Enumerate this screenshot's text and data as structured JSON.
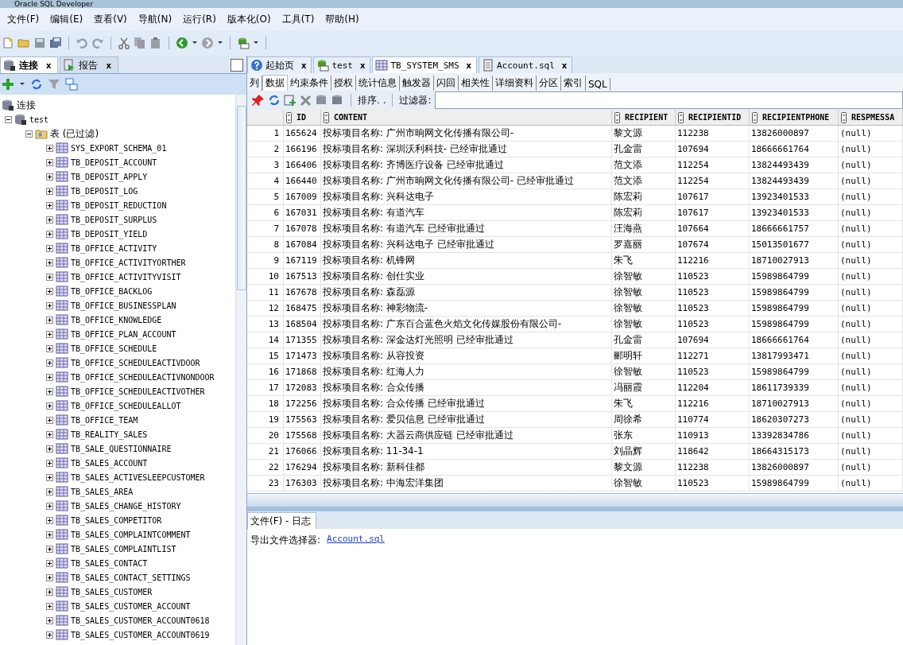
{
  "window": {
    "title": "Oracle SQL Developer"
  },
  "menu": [
    "文件(F)",
    "编辑(E)",
    "查看(V)",
    "导航(N)",
    "运行(R)",
    "版本化(O)",
    "工具(T)",
    "帮助(H)"
  ],
  "left_panel": {
    "tabs": [
      {
        "label": "连接",
        "close": "x",
        "selected": true
      },
      {
        "label": "报告",
        "close": "x",
        "selected": false
      }
    ],
    "tree": {
      "label": "连接",
      "children": [
        {
          "label": "test",
          "expanded": true,
          "children": [
            {
              "label": "表 (已过滤)",
              "expanded": true,
              "children": [
                {
                  "label": "SYS_EXPORT_SCHEMA_01",
                  "expanded": false
                },
                {
                  "label": "TB_DEPOSIT_ACCOUNT",
                  "expanded": false
                },
                {
                  "label": "TB_DEPOSIT_APPLY",
                  "expanded": false
                },
                {
                  "label": "TB_DEPOSIT_LOG",
                  "expanded": false
                },
                {
                  "label": "TB_DEPOSIT_REDUCTION",
                  "expanded": false
                },
                {
                  "label": "TB_DEPOSIT_SURPLUS",
                  "expanded": false
                },
                {
                  "label": "TB_DEPOSIT_YIELD",
                  "expanded": false
                },
                {
                  "label": "TB_OFFICE_ACTIVITY",
                  "expanded": false
                },
                {
                  "label": "TB_OFFICE_ACTIVITYORTHER",
                  "expanded": false
                },
                {
                  "label": "TB_OFFICE_ACTIVITYVISIT",
                  "expanded": false
                },
                {
                  "label": "TB_OFFICE_BACKLOG",
                  "expanded": false
                },
                {
                  "label": "TB_OFFICE_BUSINESSPLAN",
                  "expanded": false
                },
                {
                  "label": "TB_OFFICE_KNOWLEDGE",
                  "expanded": false
                },
                {
                  "label": "TB_OFFICE_PLAN_ACCOUNT",
                  "expanded": false
                },
                {
                  "label": "TB_OFFICE_SCHEDULE",
                  "expanded": false
                },
                {
                  "label": "TB_OFFICE_SCHEDULEACTIVDOOR",
                  "expanded": false
                },
                {
                  "label": "TB_OFFICE_SCHEDULEACTIVNONDOOR",
                  "expanded": false
                },
                {
                  "label": "TB_OFFICE_SCHEDULEACTIVOTHER",
                  "expanded": false
                },
                {
                  "label": "TB_OFFICE_SCHEDULEALLOT",
                  "expanded": false
                },
                {
                  "label": "TB_OFFICE_TEAM",
                  "expanded": false
                },
                {
                  "label": "TB_REALITY_SALES",
                  "expanded": false
                },
                {
                  "label": "TB_SALE_QUESTIONNAIRE",
                  "expanded": false
                },
                {
                  "label": "TB_SALES_ACCOUNT",
                  "expanded": false
                },
                {
                  "label": "TB_SALES_ACTIVESLEEPCUSTOMER",
                  "expanded": false
                },
                {
                  "label": "TB_SALES_AREA",
                  "expanded": false
                },
                {
                  "label": "TB_SALES_CHANGE_HISTORY",
                  "expanded": false
                },
                {
                  "label": "TB_SALES_COMPETITOR",
                  "expanded": false
                },
                {
                  "label": "TB_SALES_COMPLAINTCOMMENT",
                  "expanded": false
                },
                {
                  "label": "TB_SALES_COMPLAINTLIST",
                  "expanded": false
                },
                {
                  "label": "TB_SALES_CONTACT",
                  "expanded": false
                },
                {
                  "label": "TB_SALES_CONTACT_SETTINGS",
                  "expanded": false
                },
                {
                  "label": "TB_SALES_CUSTOMER",
                  "expanded": false
                },
                {
                  "label": "TB_SALES_CUSTOMER_ACCOUNT",
                  "expanded": false
                },
                {
                  "label": "TB_SALES_CUSTOMER_ACCOUNT0618",
                  "expanded": false
                },
                {
                  "label": "TB_SALES_CUSTOMER_ACCOUNT0619",
                  "expanded": false
                }
              ]
            }
          ]
        }
      ]
    }
  },
  "editor": {
    "tabs": [
      {
        "label": "起始页",
        "kind": "help",
        "close": "x",
        "selected": false
      },
      {
        "label": "test",
        "kind": "sql",
        "close": "x",
        "selected": false
      },
      {
        "label": "TB_SYSTEM_SMS",
        "kind": "table",
        "close": "x",
        "selected": true
      },
      {
        "label": "Account.sql",
        "kind": "file",
        "close": "x",
        "selected": false
      }
    ],
    "subtabs": [
      {
        "label": "列",
        "selected": false
      },
      {
        "label": "数据",
        "selected": true
      },
      {
        "label": "约束条件",
        "selected": false
      },
      {
        "label": "授权",
        "selected": false
      },
      {
        "label": "统计信息",
        "selected": false
      },
      {
        "label": "触发器",
        "selected": false
      },
      {
        "label": "闪回",
        "selected": false
      },
      {
        "label": "相关性",
        "selected": false
      },
      {
        "label": "详细资料",
        "selected": false
      },
      {
        "label": "分区",
        "selected": false
      },
      {
        "label": "索引",
        "selected": false
      },
      {
        "label": "SQL",
        "selected": false
      }
    ],
    "sort_label": "排序. .",
    "filter_label": "过滤器:",
    "table": {
      "columns": [
        "ID",
        "CONTENT",
        "RECIPIENT",
        "RECIPIENTID",
        "RECIPIENTPHONE",
        "RESPMESSA"
      ],
      "rows": [
        {
          "num": "1",
          "cells": [
            "165624",
            "投标项目名称: 广州市晌网文化传播有限公司-",
            "黎文源",
            "112238",
            "13826000897",
            "(null)"
          ]
        },
        {
          "num": "2",
          "cells": [
            "166196",
            "投标项目名称: 深圳沃利科技- 已经审批通过",
            "孔金雷",
            "107694",
            "18666661764",
            "(null)"
          ]
        },
        {
          "num": "3",
          "cells": [
            "166406",
            "投标项目名称: 齐博医疗设备 已经审批通过",
            "范文添",
            "112254",
            "13824493439",
            "(null)"
          ]
        },
        {
          "num": "4",
          "cells": [
            "166440",
            "投标项目名称: 广州市晌网文化传播有限公司- 已经审批通过",
            "范文添",
            "112254",
            "13824493439",
            "(null)"
          ]
        },
        {
          "num": "5",
          "cells": [
            "167009",
            "投标项目名称: 兴科达电子",
            "陈宏莉",
            "107617",
            "13923401533",
            "(null)"
          ]
        },
        {
          "num": "6",
          "cells": [
            "167031",
            "投标项目名称: 有道汽车",
            "陈宏莉",
            "107617",
            "13923401533",
            "(null)"
          ]
        },
        {
          "num": "7",
          "cells": [
            "167078",
            "投标项目名称: 有道汽车 已经审批通过",
            "汪海燕",
            "107664",
            "18666661757",
            "(null)"
          ]
        },
        {
          "num": "8",
          "cells": [
            "167084",
            "投标项目名称: 兴科达电子 已经审批通过",
            "罗嘉丽",
            "107674",
            "15013501677",
            "(null)"
          ]
        },
        {
          "num": "9",
          "cells": [
            "167119",
            "投标项目名称: 机锋网",
            "朱飞",
            "112216",
            "18710027913",
            "(null)"
          ]
        },
        {
          "num": "10",
          "cells": [
            "167513",
            "投标项目名称: 创仕实业",
            "徐智敏",
            "110523",
            "15989864799",
            "(null)"
          ]
        },
        {
          "num": "11",
          "cells": [
            "167678",
            "投标项目名称: 森磊源",
            "徐智敏",
            "110523",
            "15989864799",
            "(null)"
          ]
        },
        {
          "num": "12",
          "cells": [
            "168475",
            "投标项目名称: 神彩物流-",
            "徐智敏",
            "110523",
            "15989864799",
            "(null)"
          ]
        },
        {
          "num": "13",
          "cells": [
            "168504",
            "投标项目名称: 广东百合蓝色火焰文化传媒股份有限公司-",
            "徐智敏",
            "110523",
            "15989864799",
            "(null)"
          ]
        },
        {
          "num": "14",
          "cells": [
            "171355",
            "投标项目名称: 深金达灯光照明 已经审批通过",
            "孔金雷",
            "107694",
            "18666661764",
            "(null)"
          ]
        },
        {
          "num": "15",
          "cells": [
            "171473",
            "投标项目名称: 从容投资",
            "郦明轩",
            "112271",
            "13817993471",
            "(null)"
          ]
        },
        {
          "num": "16",
          "cells": [
            "171868",
            "投标项目名称: 红海人力",
            "徐智敏",
            "110523",
            "15989864799",
            "(null)"
          ]
        },
        {
          "num": "17",
          "cells": [
            "172083",
            "投标项目名称: 合众传播",
            "冯丽霞",
            "112204",
            "18611739339",
            "(null)"
          ]
        },
        {
          "num": "18",
          "cells": [
            "172256",
            "投标项目名称: 合众传播 已经审批通过",
            "朱飞",
            "112216",
            "18710027913",
            "(null)"
          ]
        },
        {
          "num": "19",
          "cells": [
            "175563",
            "投标项目名称: 爱贝信息 已经审批通过",
            "周徐希",
            "110774",
            "18620307273",
            "(null)"
          ]
        },
        {
          "num": "20",
          "cells": [
            "175568",
            "投标项目名称: 大器云商供应链 已经审批通过",
            "张东",
            "110913",
            "13392834786",
            "(null)"
          ]
        },
        {
          "num": "21",
          "cells": [
            "176066",
            "投标项目名称: 11-34-1",
            "刘晶辉",
            "118642",
            "18664315173",
            "(null)"
          ]
        },
        {
          "num": "22",
          "cells": [
            "176294",
            "投标项目名称: 新科佳都",
            "黎文源",
            "112238",
            "13826000897",
            "(null)"
          ]
        },
        {
          "num": "23",
          "cells": [
            "176303",
            "投标项目名称: 中海宏洋集团",
            "徐智敏",
            "110523",
            "15989864799",
            "(null)"
          ]
        }
      ]
    }
  },
  "log_panel": {
    "tabs": [
      {
        "label": "文件(F) - 日志",
        "selected": true
      }
    ],
    "message": "导出文件选择器:",
    "link": "Account.sql"
  }
}
